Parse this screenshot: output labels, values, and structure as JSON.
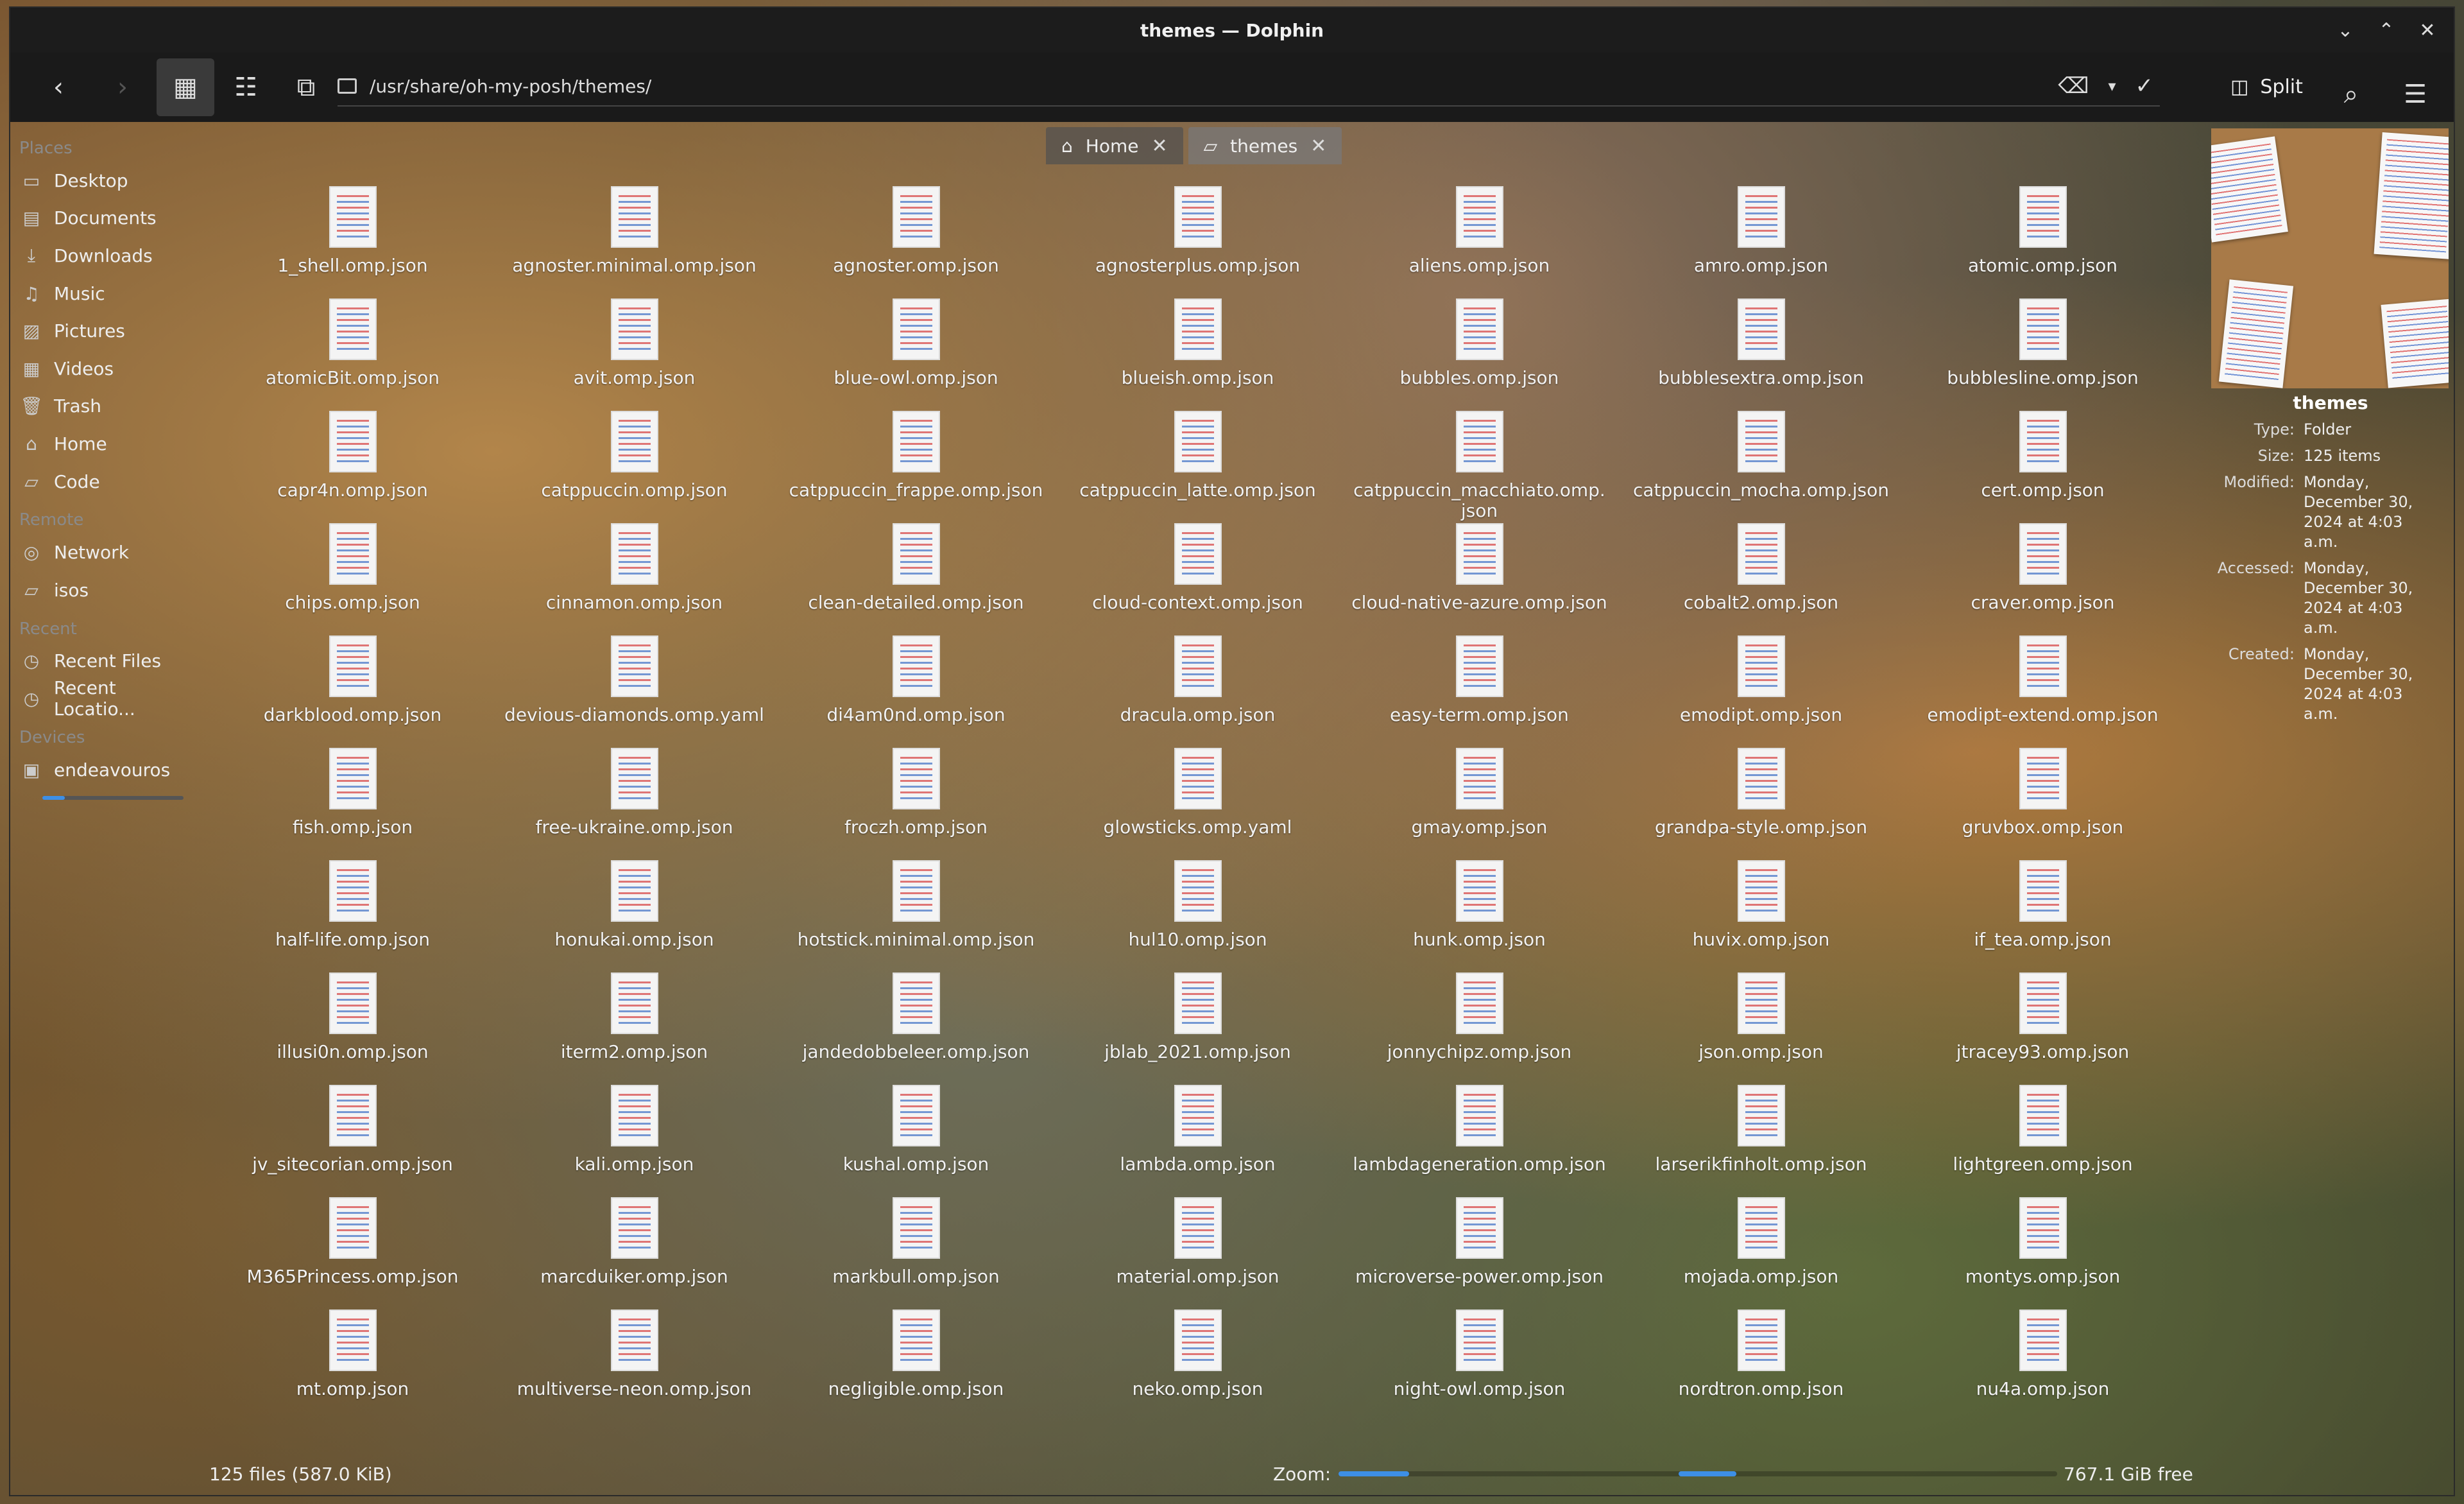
{
  "window": {
    "title": "themes — Dolphin"
  },
  "toolbar": {
    "path": "/usr/share/oh-my-posh/themes/",
    "split_label": "Split"
  },
  "sidebar": {
    "sections": [
      {
        "title": "Places",
        "items": [
          {
            "label": "Desktop",
            "icon": "desktop-icon",
            "glyph": "▭"
          },
          {
            "label": "Documents",
            "icon": "documents-icon",
            "glyph": "▤"
          },
          {
            "label": "Downloads",
            "icon": "downloads-icon",
            "glyph": "⤓"
          },
          {
            "label": "Music",
            "icon": "music-icon",
            "glyph": "♫"
          },
          {
            "label": "Pictures",
            "icon": "pictures-icon",
            "glyph": "▨"
          },
          {
            "label": "Videos",
            "icon": "videos-icon",
            "glyph": "▦"
          },
          {
            "label": "Trash",
            "icon": "trash-icon",
            "glyph": "🗑"
          },
          {
            "label": "Home",
            "icon": "home-icon",
            "glyph": "⌂"
          },
          {
            "label": "Code",
            "icon": "folder-icon",
            "glyph": "▱"
          }
        ]
      },
      {
        "title": "Remote",
        "items": [
          {
            "label": "Network",
            "icon": "network-icon",
            "glyph": "◎"
          },
          {
            "label": "isos",
            "icon": "folder-icon",
            "glyph": "▱"
          }
        ]
      },
      {
        "title": "Recent",
        "items": [
          {
            "label": "Recent Files",
            "icon": "recent-files-icon",
            "glyph": "◷"
          },
          {
            "label": "Recent Locatio...",
            "icon": "recent-locations-icon",
            "glyph": "◷"
          }
        ]
      },
      {
        "title": "Devices",
        "items": [
          {
            "label": "endeavouros",
            "icon": "drive-icon",
            "glyph": "▣"
          }
        ]
      }
    ]
  },
  "tabs": [
    {
      "label": "Home",
      "icon": "home-icon"
    },
    {
      "label": "themes",
      "icon": "folder-icon"
    }
  ],
  "files": [
    "1_shell.omp.json",
    "agnoster.minimal.omp.json",
    "agnoster.omp.json",
    "agnosterplus.omp.json",
    "aliens.omp.json",
    "amro.omp.json",
    "atomic.omp.json",
    "atomicBit.omp.json",
    "avit.omp.json",
    "blue-owl.omp.json",
    "blueish.omp.json",
    "bubbles.omp.json",
    "bubblesextra.omp.json",
    "bubblesline.omp.json",
    "capr4n.omp.json",
    "catppuccin.omp.json",
    "catppuccin_frappe.omp.json",
    "catppuccin_latte.omp.json",
    "catppuccin_macchiato.omp.\njson",
    "catppuccin_mocha.omp.json",
    "cert.omp.json",
    "chips.omp.json",
    "cinnamon.omp.json",
    "clean-detailed.omp.json",
    "cloud-context.omp.json",
    "cloud-native-azure.omp.json",
    "cobalt2.omp.json",
    "craver.omp.json",
    "darkblood.omp.json",
    "devious-diamonds.omp.yaml",
    "di4am0nd.omp.json",
    "dracula.omp.json",
    "easy-term.omp.json",
    "emodipt.omp.json",
    "emodipt-extend.omp.json",
    "fish.omp.json",
    "free-ukraine.omp.json",
    "froczh.omp.json",
    "glowsticks.omp.yaml",
    "gmay.omp.json",
    "grandpa-style.omp.json",
    "gruvbox.omp.json",
    "half-life.omp.json",
    "honukai.omp.json",
    "hotstick.minimal.omp.json",
    "hul10.omp.json",
    "hunk.omp.json",
    "huvix.omp.json",
    "if_tea.omp.json",
    "illusi0n.omp.json",
    "iterm2.omp.json",
    "jandedobbeleer.omp.json",
    "jblab_2021.omp.json",
    "jonnychipz.omp.json",
    "json.omp.json",
    "jtracey93.omp.json",
    "jv_sitecorian.omp.json",
    "kali.omp.json",
    "kushal.omp.json",
    "lambda.omp.json",
    "lambdageneration.omp.json",
    "larserikfinholt.omp.json",
    "lightgreen.omp.json",
    "M365Princess.omp.json",
    "marcduiker.omp.json",
    "markbull.omp.json",
    "material.omp.json",
    "microverse-power.omp.json",
    "mojada.omp.json",
    "montys.omp.json",
    "mt.omp.json",
    "multiverse-neon.omp.json",
    "negligible.omp.json",
    "neko.omp.json",
    "night-owl.omp.json",
    "nordtron.omp.json",
    "nu4a.omp.json"
  ],
  "info": {
    "name": "themes",
    "rows": [
      {
        "key": "Type:",
        "value": "Folder"
      },
      {
        "key": "Size:",
        "value": "125 items"
      },
      {
        "key": "Modified:",
        "value": "Monday, December 30, 2024 at 4:03 a.m."
      },
      {
        "key": "Accessed:",
        "value": "Monday, December 30, 2024 at 4:03 a.m."
      },
      {
        "key": "Created:",
        "value": "Monday, December 30, 2024 at 4:03 a.m."
      }
    ]
  },
  "status": {
    "count": "125 files (587.0 KiB)",
    "zoom_label": "Zoom:",
    "free": "767.1 GiB free",
    "zoom_level": 0.04,
    "device_usage": 0.16
  },
  "colors": {
    "accent": "#3d8fe6",
    "titlebar": "#1c1c1c"
  }
}
